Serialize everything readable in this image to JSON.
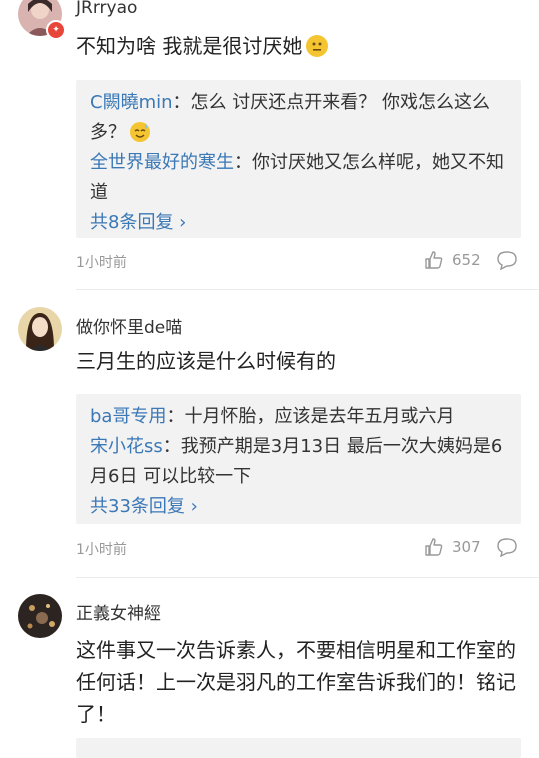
{
  "comments": [
    {
      "username": "JRrryao",
      "text": "不知为啥 我就是很讨厌她",
      "emoji": "neutral-face-emoji",
      "replies": [
        {
          "user": "C闕曉min",
          "text": "：怎么 讨厌还点开来看？ 你戏怎么这么多？"
        },
        {
          "user": "全世界最好的寒生",
          "text": "：你讨厌她又怎么样呢，她又不知道"
        }
      ],
      "more_replies": "共8条回复",
      "time": "1小时前",
      "likes": "652"
    },
    {
      "username": "做你怀里de喵",
      "text": "三月生的应该是什么时候有的",
      "replies": [
        {
          "user": "ba哥专用",
          "text": "：十月怀胎，应该是去年五月或六月"
        },
        {
          "user": "宋小花ss",
          "text": "：我预产期是3月13日 最后一次大姨妈是6月6日 可以比较一下"
        }
      ],
      "more_replies": "共33条回复",
      "time": "1小时前",
      "likes": "307"
    },
    {
      "username": "正義女神經",
      "text": "这件事又一次告诉素人，不要相信明星和工作室的任何话！上一次是羽凡的工作室告诉我们的！铭记了！"
    }
  ],
  "colors": {
    "link": "#3a78b6",
    "meta": "#999999",
    "reply_bg": "#f2f2f2"
  }
}
